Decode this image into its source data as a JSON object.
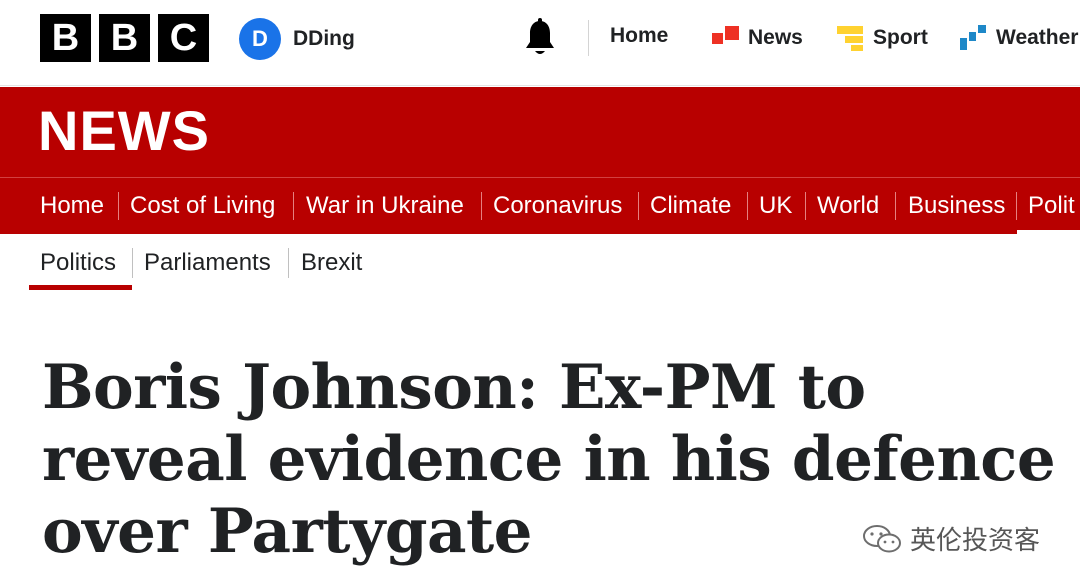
{
  "logo": {
    "letters": [
      "B",
      "B",
      "C"
    ]
  },
  "account": {
    "initial": "D",
    "name": "DDing",
    "avatar_color": "#1a73e8"
  },
  "top_nav": [
    {
      "label": "Home"
    },
    {
      "label": "News",
      "icon": "news-icon"
    },
    {
      "label": "Sport",
      "icon": "sport-icon"
    },
    {
      "label": "Weather",
      "icon": "weather-icon"
    }
  ],
  "banner": {
    "title": "NEWS",
    "color": "#b80000"
  },
  "section_nav": [
    {
      "label": "Home"
    },
    {
      "label": "Cost of Living"
    },
    {
      "label": "War in Ukraine"
    },
    {
      "label": "Coronavirus"
    },
    {
      "label": "Climate"
    },
    {
      "label": "UK"
    },
    {
      "label": "World"
    },
    {
      "label": "Business"
    },
    {
      "label": "Polit"
    }
  ],
  "sub_nav": [
    {
      "label": "Politics"
    },
    {
      "label": "Parliaments"
    },
    {
      "label": "Brexit"
    }
  ],
  "headline": "Boris Johnson: Ex-PM to reveal evidence in his defence over Partygate",
  "watermark": {
    "text": "英伦投资客"
  }
}
